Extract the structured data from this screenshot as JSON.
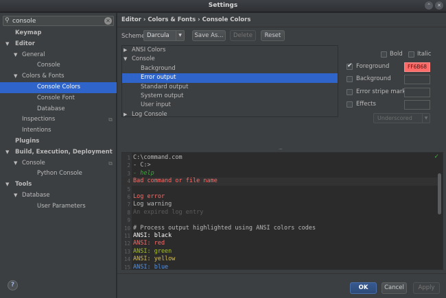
{
  "window": {
    "title": "Settings",
    "buttons": [
      "⌃",
      "✕"
    ]
  },
  "sidebar": {
    "search": {
      "icon": "search-icon",
      "value": "console",
      "clear_icon": "clear-icon",
      "clear_glyph": "✕"
    },
    "nodes": [
      {
        "label": "Keymap",
        "bold": true,
        "level": 0,
        "arrow": ""
      },
      {
        "label": "Editor",
        "bold": true,
        "level": 0,
        "arrow": "▼"
      },
      {
        "label": "General",
        "bold": false,
        "level": 1,
        "arrow": "▼"
      },
      {
        "label": "Console",
        "bold": false,
        "level": 2,
        "arrow": ""
      },
      {
        "label": "Colors & Fonts",
        "bold": false,
        "level": 1,
        "arrow": "▼"
      },
      {
        "label": "Console Colors",
        "bold": false,
        "level": 2,
        "arrow": "",
        "selected": true
      },
      {
        "label": "Console Font",
        "bold": false,
        "level": 2,
        "arrow": ""
      },
      {
        "label": "Database",
        "bold": false,
        "level": 2,
        "arrow": ""
      },
      {
        "label": "Inspections",
        "bold": false,
        "level": 1,
        "arrow": "",
        "copy": true
      },
      {
        "label": "Intentions",
        "bold": false,
        "level": 1,
        "arrow": ""
      },
      {
        "label": "Plugins",
        "bold": true,
        "level": 0,
        "arrow": ""
      },
      {
        "label": "Build, Execution, Deployment",
        "bold": true,
        "level": 0,
        "arrow": "▼"
      },
      {
        "label": "Console",
        "bold": false,
        "level": 1,
        "arrow": "▼",
        "copy": true
      },
      {
        "label": "Python Console",
        "bold": false,
        "level": 2,
        "arrow": ""
      },
      {
        "label": "Tools",
        "bold": true,
        "level": 0,
        "arrow": "▼"
      },
      {
        "label": "Database",
        "bold": false,
        "level": 1,
        "arrow": "▼"
      },
      {
        "label": "User Parameters",
        "bold": false,
        "level": 2,
        "arrow": ""
      }
    ],
    "help_label": "?"
  },
  "main": {
    "breadcrumb": "Editor › Colors & Fonts › Console Colors",
    "scheme": {
      "label": "Scheme:",
      "value": "Darcula",
      "save_as": "Save As...",
      "delete": "Delete",
      "reset": "Reset"
    },
    "element_tree": [
      {
        "label": "ANSI Colors",
        "level": 0,
        "arrow": "▶"
      },
      {
        "label": "Console",
        "level": 0,
        "arrow": "▼"
      },
      {
        "label": "Background",
        "level": 1,
        "arrow": ""
      },
      {
        "label": "Error output",
        "level": 1,
        "arrow": "",
        "selected": true
      },
      {
        "label": "Standard output",
        "level": 1,
        "arrow": ""
      },
      {
        "label": "System output",
        "level": 1,
        "arrow": ""
      },
      {
        "label": "User input",
        "level": 1,
        "arrow": ""
      },
      {
        "label": "Log Console",
        "level": 0,
        "arrow": "▶"
      }
    ],
    "properties": {
      "bold": {
        "label": "Bold",
        "checked": false
      },
      "italic": {
        "label": "Italic",
        "checked": false
      },
      "foreground": {
        "label": "Foreground",
        "checked": true,
        "value": "FF6B68",
        "color": "#FF6B68"
      },
      "background": {
        "label": "Background",
        "checked": false
      },
      "error_stripe": {
        "label": "Error stripe mark",
        "checked": false
      },
      "effects": {
        "label": "Effects",
        "checked": false
      },
      "effect_type": "Underscored"
    },
    "preview": {
      "lines": [
        {
          "n": "1",
          "text": "C:\\command.com",
          "color": "#bbbbbb"
        },
        {
          "n": "2",
          "text": "- C:>",
          "color": "#bbbbbb"
        },
        {
          "n": "3",
          "text": "- help",
          "color": "#3fa33f",
          "italic": true
        },
        {
          "n": "4",
          "text": "Bad command or file name",
          "color": "#ff6b68",
          "highlight": true
        },
        {
          "n": "5",
          "text": "",
          "color": "#bbbbbb"
        },
        {
          "n": "6",
          "text": "Log error",
          "color": "#ff6b68"
        },
        {
          "n": "7",
          "text": "Log warning",
          "color": "#bbbbbb"
        },
        {
          "n": "8",
          "text": "An expired log entry",
          "color": "#5c5c5c"
        },
        {
          "n": "9",
          "text": "",
          "color": "#bbbbbb"
        },
        {
          "n": "10",
          "text": "# Process output highlighted using ANSI colors codes",
          "color": "#bbbbbb"
        },
        {
          "n": "11",
          "text": "ANSI: black",
          "color": "#ffffff"
        },
        {
          "n": "12",
          "text": "ANSI: red",
          "color": "#ff6b68"
        },
        {
          "n": "13",
          "text": "ANSI: green",
          "color": "#a8c023"
        },
        {
          "n": "14",
          "text": "ANSI: yellow",
          "color": "#d6bf55"
        },
        {
          "n": "15",
          "text": "ANSI: blue",
          "color": "#5394ec"
        }
      ]
    }
  },
  "footer": {
    "ok": "OK",
    "cancel": "Cancel",
    "apply": "Apply"
  }
}
